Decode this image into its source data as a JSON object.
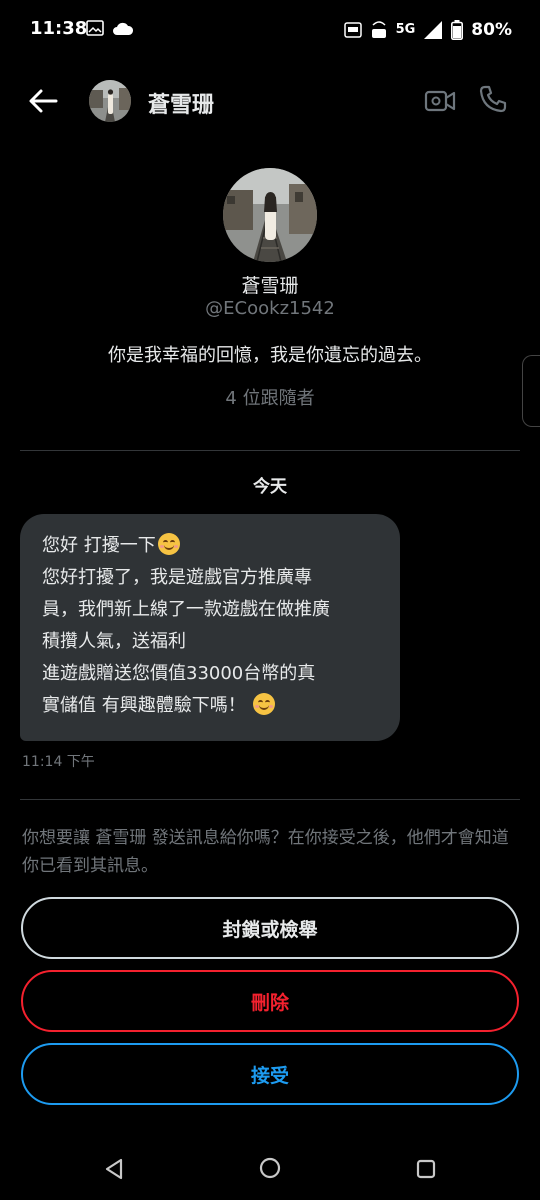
{
  "status_bar": {
    "time": "11:38",
    "network": "5G",
    "battery": "80%",
    "icons": [
      "image-icon",
      "cloud-icon",
      "auto-icon",
      "volte-icon",
      "signal-icon",
      "battery-icon"
    ]
  },
  "header": {
    "name": "蒼雪珊",
    "icons": [
      "back-arrow-icon",
      "video-call-icon",
      "phone-icon"
    ]
  },
  "profile": {
    "name": "蒼雪珊",
    "handle": "@ECookz1542",
    "bio": "你是我幸福的回憶，我是你遺忘的過去。",
    "followers": "4 位跟隨者"
  },
  "conversation": {
    "date_label": "今天",
    "message": {
      "lines": [
        "您好  打擾一下",
        "您好打擾了，我是遊戲官方推廣專",
        "員，我們新上線了一款遊戲在做推廣",
        "積攢人氣，送福利",
        "進遊戲贈送您價值33000台幣的真",
        "實儲值  有興趣體驗下嗎！"
      ],
      "emoji": "smiling-face-icon",
      "time": "11:14 下午"
    }
  },
  "request": {
    "prompt": "你想要讓 蒼雪珊 發送訊息給你嗎？在你接受之後，他們才會知道你已看到其訊息。",
    "block_label": "封鎖或檢舉",
    "delete_label": "刪除",
    "accept_label": "接受"
  },
  "colors": {
    "background": "#000000",
    "bubble": "#2f3336",
    "secondary_text": "#71767b",
    "delete": "#f4212e",
    "accept": "#1d9bf0"
  }
}
